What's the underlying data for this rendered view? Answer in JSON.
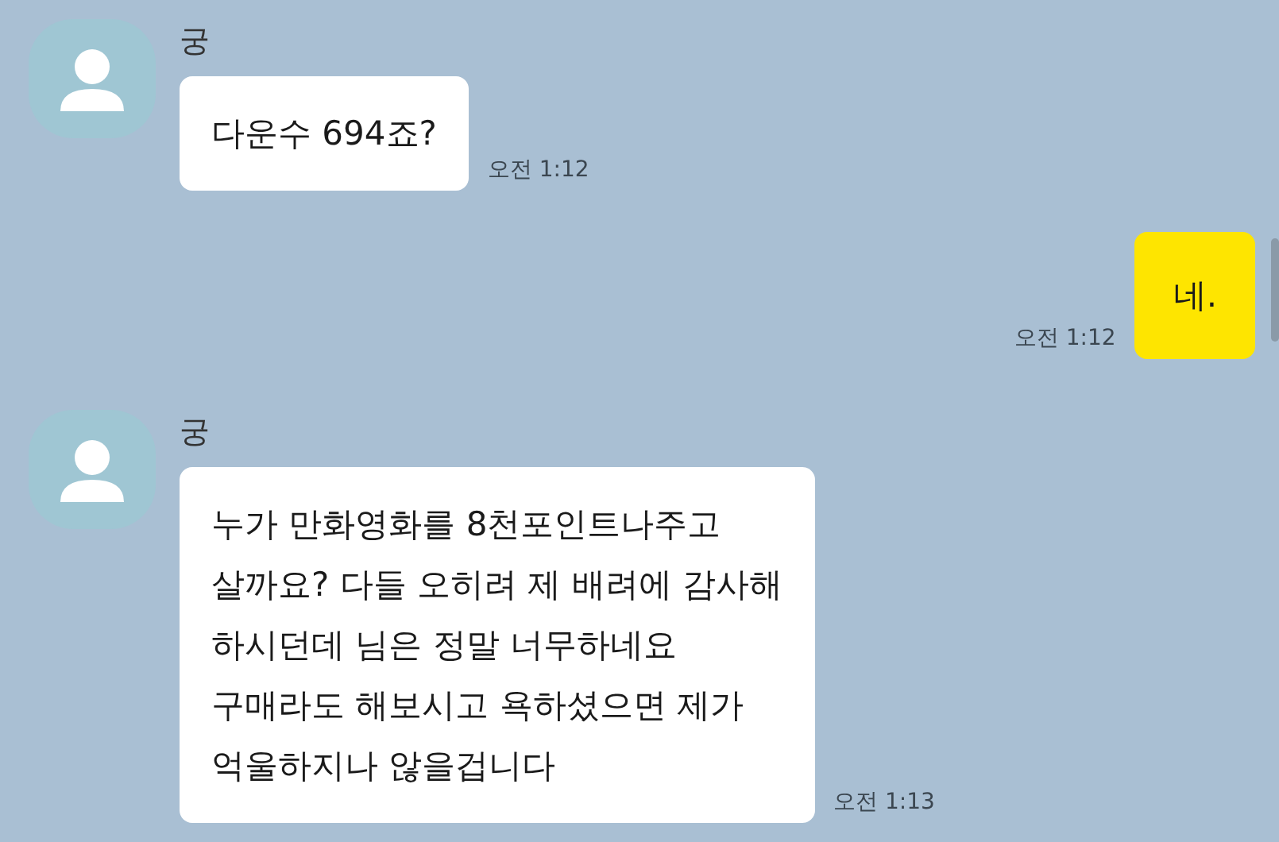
{
  "messages": [
    {
      "kind": "incoming",
      "sender": "궁",
      "text": "다운수 694죠?",
      "time": "오전 1:12"
    },
    {
      "kind": "outgoing",
      "text": "네.",
      "time": "오전 1:12"
    },
    {
      "kind": "incoming",
      "sender": "궁",
      "text": "누가 만화영화를 8천포인트나주고\n살까요?  다들 오히려 제 배려에 감사해\n하시던데 님은 정말 너무하네요\n구매라도 해보시고 욕하셨으면 제가\n억울하지나 않을겁니다",
      "time": "오전 1:13"
    }
  ]
}
